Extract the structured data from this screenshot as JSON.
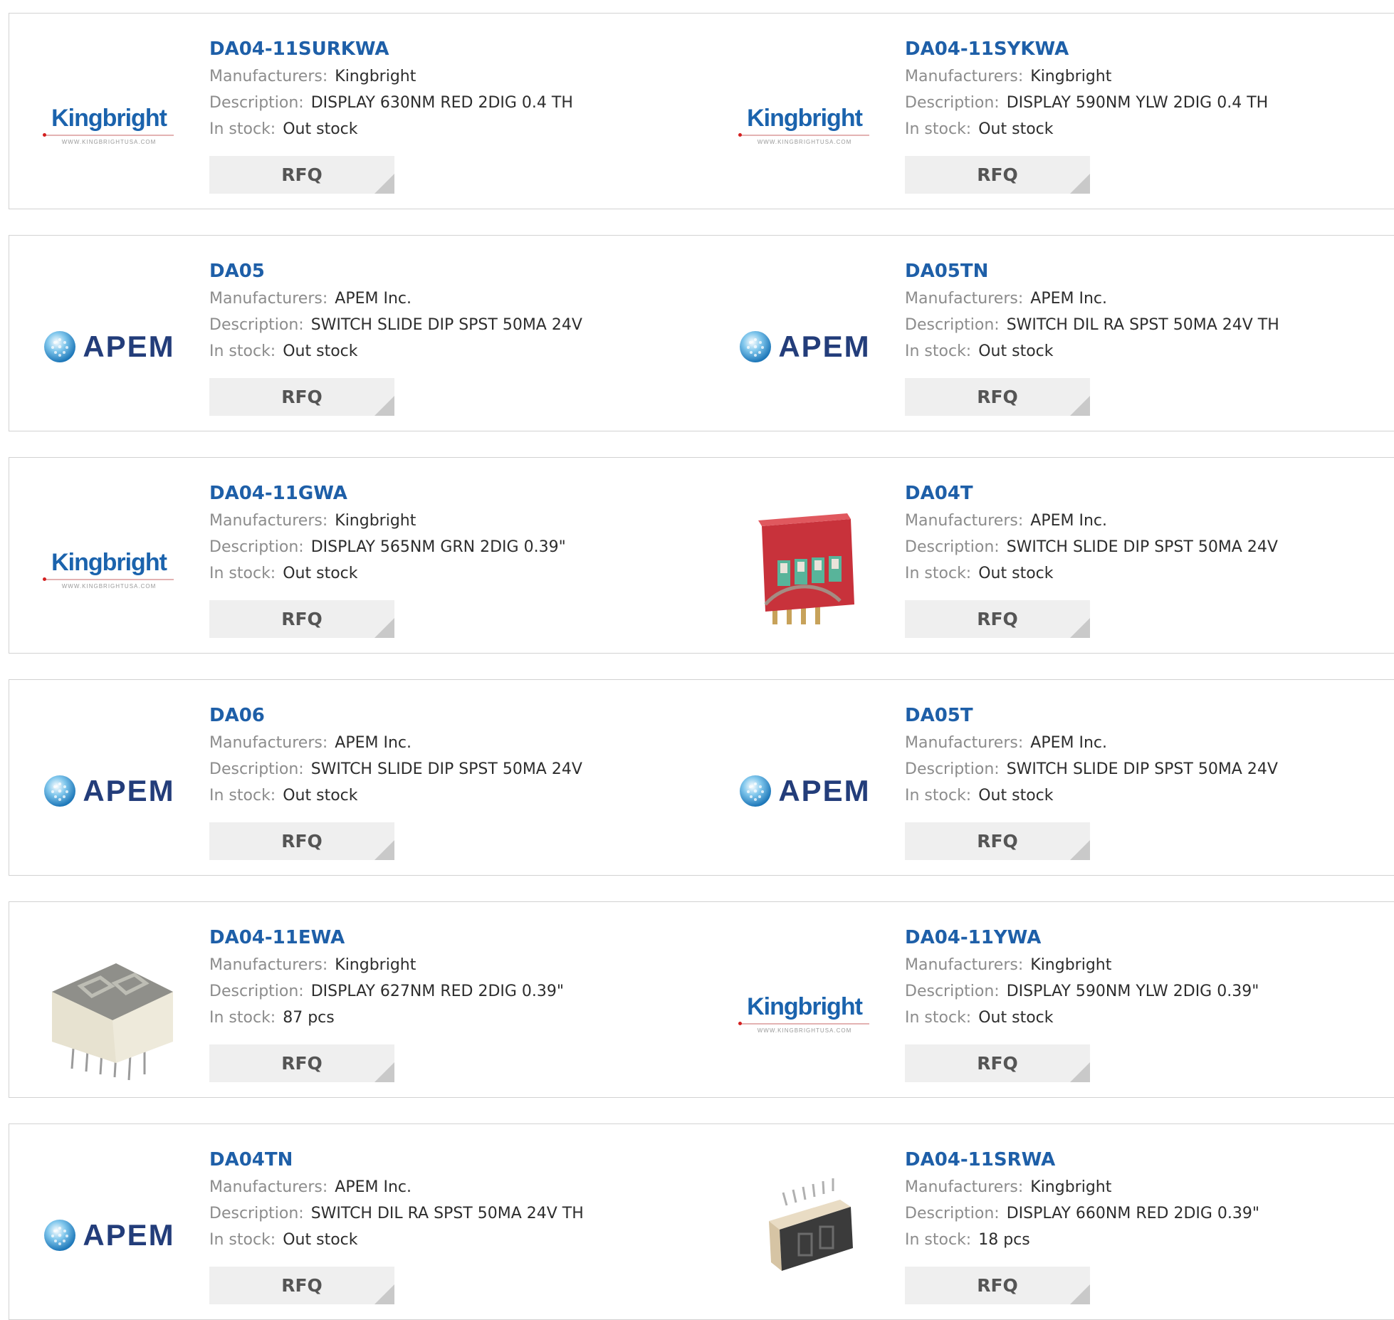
{
  "labels": {
    "manufacturers": "Manufacturers:",
    "description": "Description:",
    "stock": "In stock:",
    "rfq": "RFQ"
  },
  "logos": {
    "kingbright": {
      "word": "Kingbright",
      "url": "WWW.KINGBRIGHTUSA.COM"
    },
    "apem": {
      "word": "APEM"
    }
  },
  "colors": {
    "part_link": "#1e5fa8",
    "label": "#8c8c8c",
    "value": "#2d2d2d",
    "button_bg": "#efefef",
    "kingbright_blue": "#1b63ad",
    "apem_navy": "#233d7a"
  },
  "products": [
    {
      "part": "DA04-11SURKWA",
      "manufacturer": "Kingbright",
      "description": "DISPLAY 630NM RED 2DIG 0.4 TH",
      "stock": "Out stock",
      "image": "kingbright-logo"
    },
    {
      "part": "DA04-11SYKWA",
      "manufacturer": "Kingbright",
      "description": "DISPLAY 590NM YLW 2DIG 0.4 TH",
      "stock": "Out stock",
      "image": "kingbright-logo"
    },
    {
      "part": "DA05",
      "manufacturer": "APEM Inc.",
      "description": "SWITCH SLIDE DIP SPST 50MA 24V",
      "stock": "Out stock",
      "image": "apem-logo"
    },
    {
      "part": "DA05TN",
      "manufacturer": "APEM Inc.",
      "description": "SWITCH DIL RA SPST 50MA 24V TH",
      "stock": "Out stock",
      "image": "apem-logo"
    },
    {
      "part": "DA04-11GWA",
      "manufacturer": "Kingbright",
      "description": "DISPLAY 565NM GRN 2DIG 0.39\"",
      "stock": "Out stock",
      "image": "kingbright-logo"
    },
    {
      "part": "DA04T",
      "manufacturer": "APEM Inc.",
      "description": "SWITCH SLIDE DIP SPST 50MA 24V",
      "stock": "Out stock",
      "image": "dip-switch-photo"
    },
    {
      "part": "DA06",
      "manufacturer": "APEM Inc.",
      "description": "SWITCH SLIDE DIP SPST 50MA 24V",
      "stock": "Out stock",
      "image": "apem-logo"
    },
    {
      "part": "DA05T",
      "manufacturer": "APEM Inc.",
      "description": "SWITCH SLIDE DIP SPST 50MA 24V",
      "stock": "Out stock",
      "image": "apem-logo"
    },
    {
      "part": "DA04-11EWA",
      "manufacturer": "Kingbright",
      "description": "DISPLAY 627NM RED 2DIG 0.39\"",
      "stock": "87 pcs",
      "image": "seven-segment-photo"
    },
    {
      "part": "DA04-11YWA",
      "manufacturer": "Kingbright",
      "description": "DISPLAY 590NM YLW 2DIG 0.39\"",
      "stock": "Out stock",
      "image": "kingbright-logo"
    },
    {
      "part": "DA04TN",
      "manufacturer": "APEM Inc.",
      "description": "SWITCH DIL RA SPST 50MA 24V TH",
      "stock": "Out stock",
      "image": "apem-logo"
    },
    {
      "part": "DA04-11SRWA",
      "manufacturer": "Kingbright",
      "description": "DISPLAY 660NM RED 2DIG 0.39\"",
      "stock": "18 pcs",
      "image": "seven-segment-small-photo"
    }
  ]
}
